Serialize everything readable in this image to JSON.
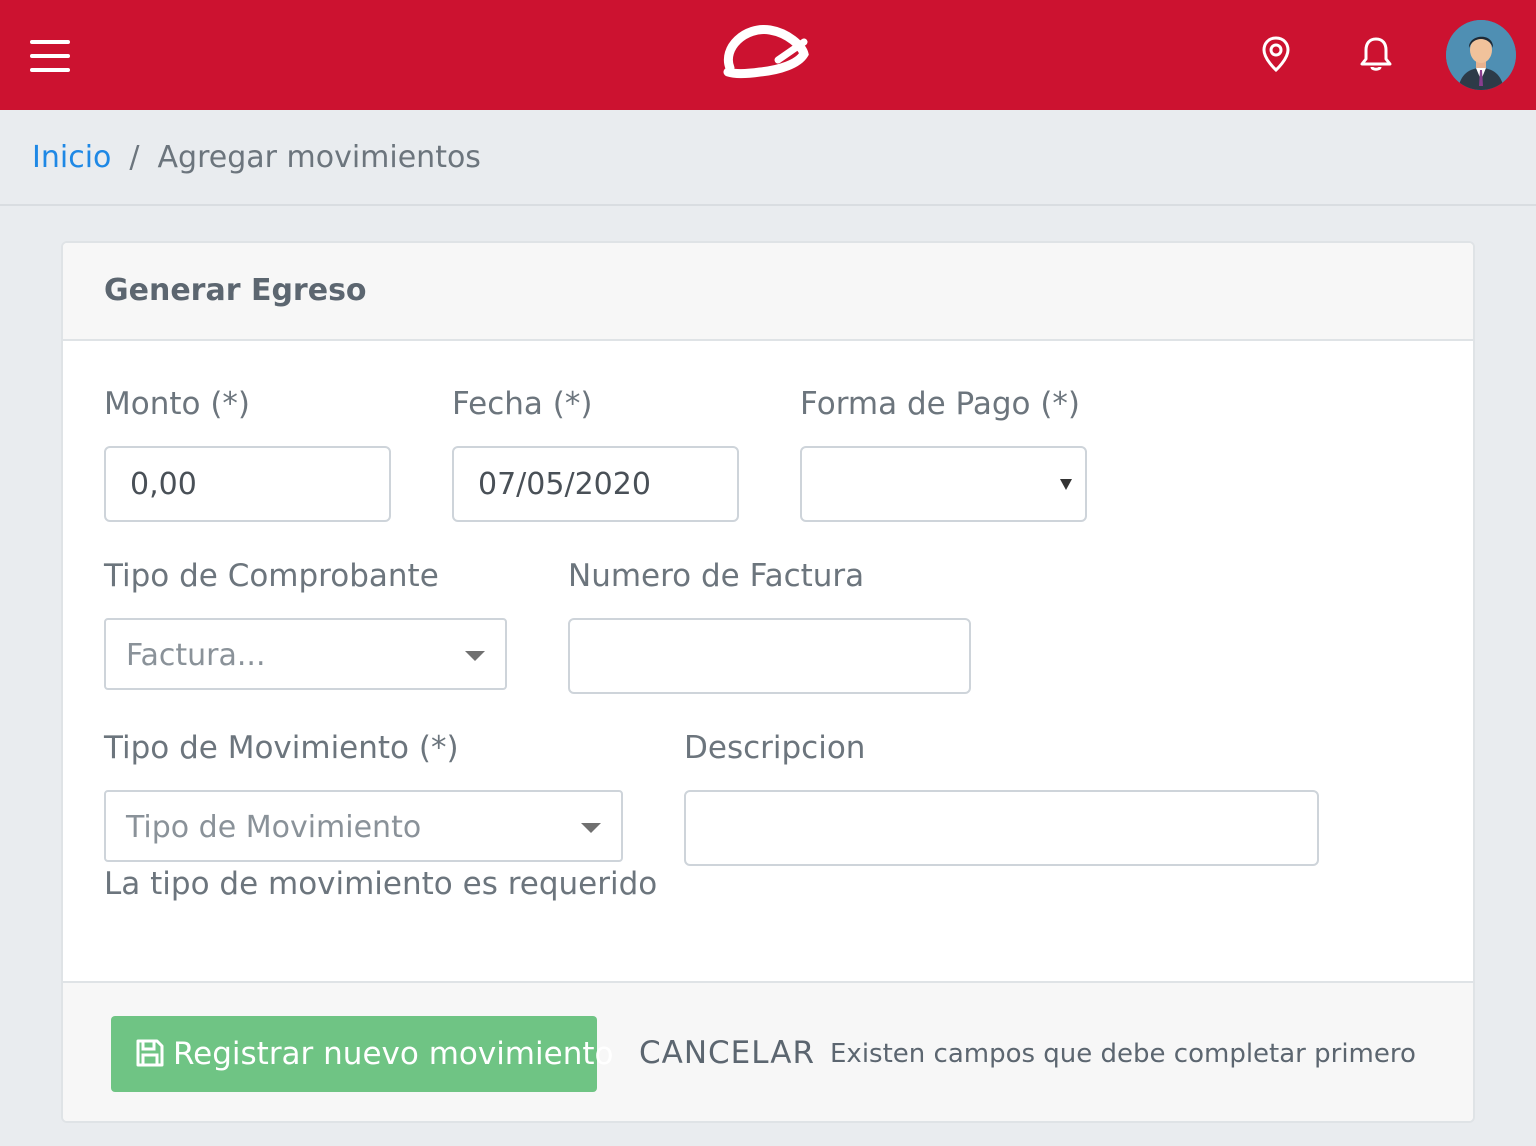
{
  "topbar": {
    "icons": [
      "hamburger-menu-icon",
      "logo",
      "map-pin-icon",
      "bell-icon",
      "user-avatar"
    ],
    "color": "#cc1230"
  },
  "breadcrumb": {
    "home": "Inicio",
    "separator": "/",
    "current": "Agregar movimientos"
  },
  "card": {
    "title": "Generar Egreso"
  },
  "form": {
    "monto": {
      "label": "Monto (*)",
      "value": "0,00"
    },
    "fecha": {
      "label": "Fecha (*)",
      "value": "07/05/2020"
    },
    "forma_pago": {
      "label": "Forma de Pago (*)",
      "value": ""
    },
    "tipo_comprobante": {
      "label": "Tipo de Comprobante",
      "placeholder": "Factura..."
    },
    "numero_factura": {
      "label": "Numero de Factura",
      "value": ""
    },
    "tipo_movimiento": {
      "label": "Tipo de Movimiento (*)",
      "placeholder": "Tipo de Movimiento",
      "error": "La tipo de movimiento es requerido"
    },
    "descripcion": {
      "label": "Descripcion",
      "value": ""
    }
  },
  "footer": {
    "submit_label": "Registrar nuevo movimiento",
    "submit_color": "#6fc484",
    "cancel_label": "CANCELAR",
    "message": "Existen campos que debe completar primero"
  }
}
